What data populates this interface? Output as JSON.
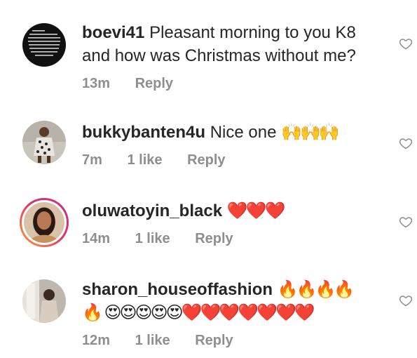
{
  "comments": [
    {
      "username": "boevi41",
      "text": "Pleasant morning to you K8 and how was Christmas without me?",
      "emoji": "",
      "time": "13m",
      "likes": "",
      "reply_label": "Reply"
    },
    {
      "username": "bukkybanten4u",
      "text": "Nice one",
      "emoji": "🙌🙌🙌",
      "time": "7m",
      "likes": "1 like",
      "reply_label": "Reply"
    },
    {
      "username": "oluwatoyin_black",
      "text": "",
      "emoji": "❤️❤️❤️",
      "time": "14m",
      "likes": "1 like",
      "reply_label": "Reply"
    },
    {
      "username": "sharon_houseoffashion",
      "text": "",
      "emoji": "🔥🔥🔥🔥🔥 😍😍😍😍😍❤️❤️❤️❤️❤️❤️❤️",
      "time": "12m",
      "likes": "1 like",
      "reply_label": "Reply"
    }
  ],
  "icons": {
    "like": "heart-outline-icon",
    "avatar_story_ring": "story-ring"
  },
  "colors": {
    "text": "#262626",
    "meta": "#8e8e8e",
    "heart_outline": "#8e8e8e"
  }
}
